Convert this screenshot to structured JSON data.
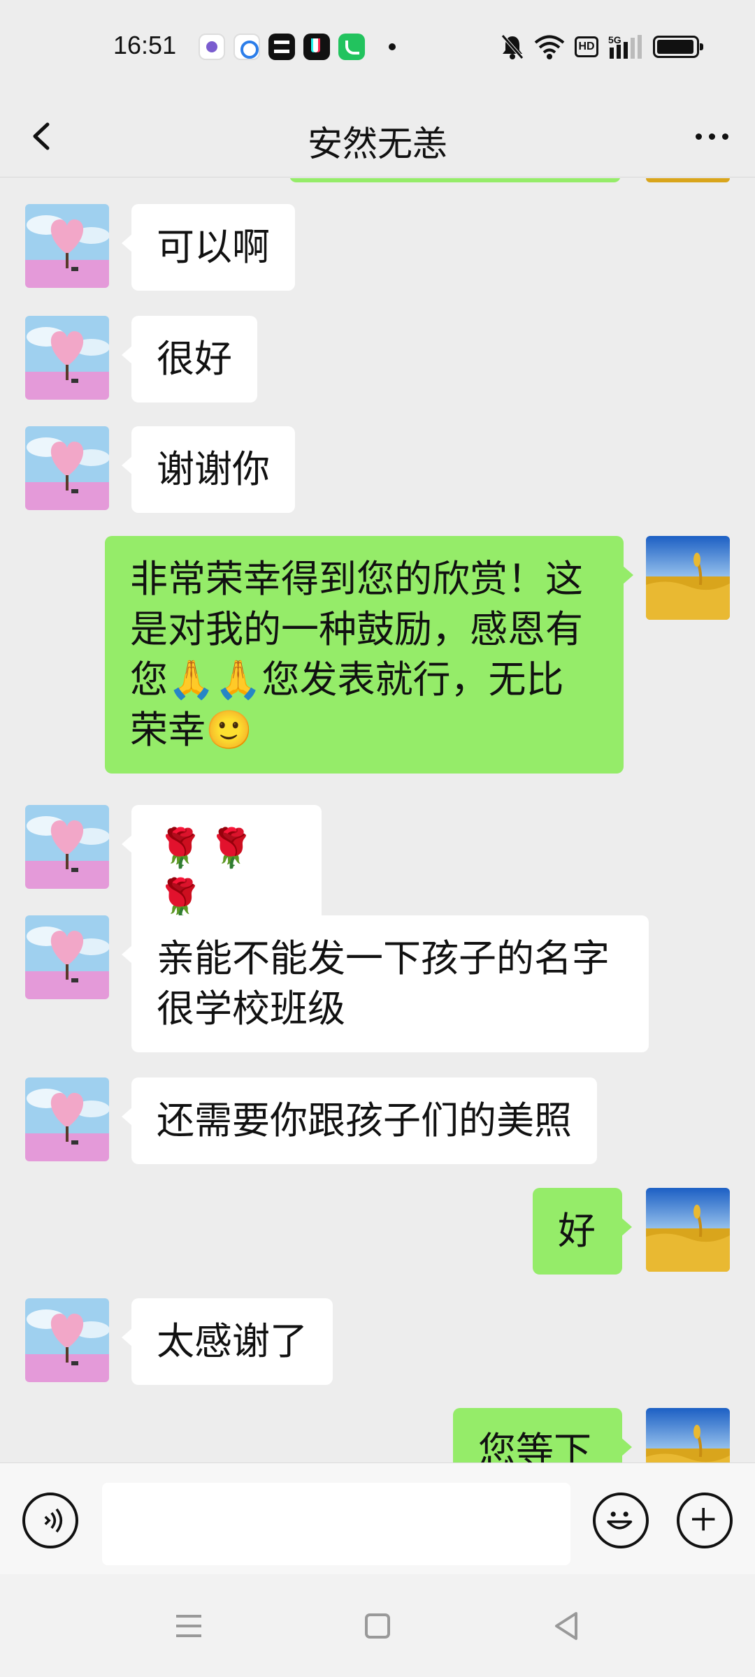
{
  "status_bar": {
    "time": "16:51",
    "left_icons": [
      "app-bubble-icon",
      "browser-icon",
      "capcut-icon",
      "tiktok-icon",
      "phone-call-icon"
    ],
    "right_icons": [
      "bell-off-icon",
      "wifi-icon",
      "hd-icon",
      "signal-5g-icon",
      "battery-icon"
    ],
    "hd_label": "HD"
  },
  "header": {
    "title": "安然无恙",
    "back_icon": "chevron-left-icon",
    "more_icon": "more-dots-icon"
  },
  "messages": [
    {
      "side": "left",
      "text": "可以啊"
    },
    {
      "side": "left",
      "text": "很好"
    },
    {
      "side": "left",
      "text": "谢谢你"
    },
    {
      "side": "right",
      "text": "非常荣幸得到您的欣赏！这是对我的一种鼓励，感恩有您🙏🙏您发表就行，无比荣幸🙂"
    },
    {
      "side": "left",
      "text": "🌹🌹🌹"
    },
    {
      "side": "left",
      "text": "亲能不能发一下孩子的名字很学校班级"
    },
    {
      "side": "left",
      "text": "还需要你跟孩子们的美照"
    },
    {
      "side": "right",
      "text": "好"
    },
    {
      "side": "left",
      "text": "太感谢了"
    },
    {
      "side": "right",
      "text": "您等下"
    }
  ],
  "input_bar": {
    "voice_icon": "voice-icon",
    "emoji_icon": "emoji-icon",
    "plus_icon": "plus-icon",
    "text_value": ""
  },
  "nav_bar": {
    "menu_icon": "menu-icon",
    "home_icon": "home-square-icon",
    "back_icon": "back-triangle-icon"
  },
  "colors": {
    "background": "#ededed",
    "bubble_self": "#95ec69",
    "bubble_other": "#ffffff"
  }
}
